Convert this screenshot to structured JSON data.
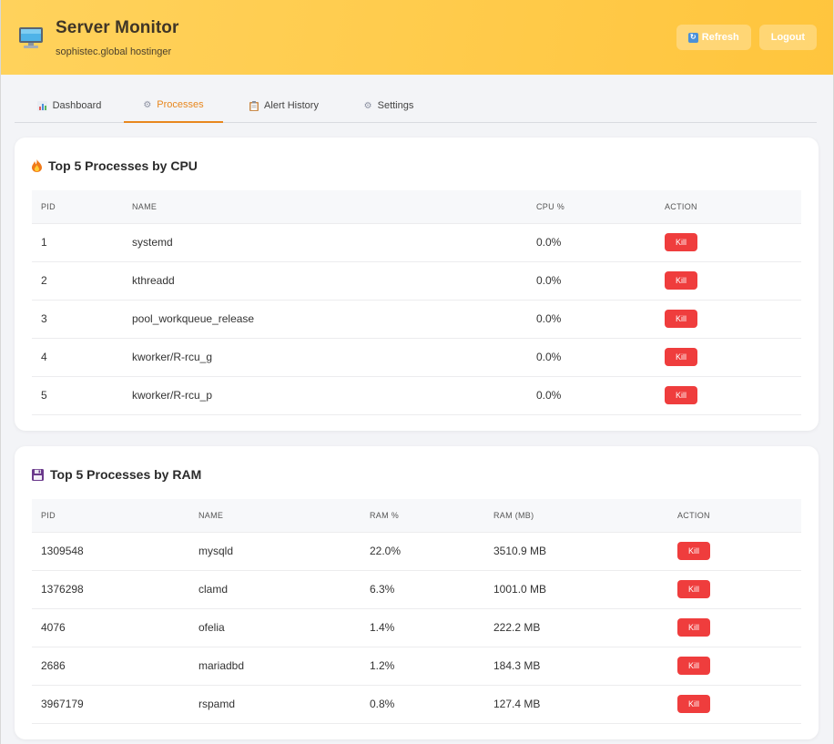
{
  "header": {
    "title": "Server Monitor",
    "subtitle": "sophistec.global hostinger",
    "refresh_label": "Refresh",
    "logout_label": "Logout",
    "logo_icon": "monitor-icon",
    "accent": "#ffc53d"
  },
  "tabs": [
    {
      "label": "Dashboard",
      "icon": "chart-icon",
      "active": false
    },
    {
      "label": "Processes",
      "icon": "gear-icon",
      "active": true
    },
    {
      "label": "Alert History",
      "icon": "clipboard-icon",
      "active": false
    },
    {
      "label": "Settings",
      "icon": "gear-icon",
      "active": false
    }
  ],
  "cpu_card": {
    "title": "Top 5 Processes by CPU",
    "icon": "fire-icon",
    "columns": [
      "PID",
      "NAME",
      "CPU %",
      "ACTION"
    ],
    "rows": [
      {
        "pid": "1",
        "name": "systemd",
        "cpu": "0.0%",
        "action": "Kill"
      },
      {
        "pid": "2",
        "name": "kthreadd",
        "cpu": "0.0%",
        "action": "Kill"
      },
      {
        "pid": "3",
        "name": "pool_workqueue_release",
        "cpu": "0.0%",
        "action": "Kill"
      },
      {
        "pid": "4",
        "name": "kworker/R-rcu_g",
        "cpu": "0.0%",
        "action": "Kill"
      },
      {
        "pid": "5",
        "name": "kworker/R-rcu_p",
        "cpu": "0.0%",
        "action": "Kill"
      }
    ]
  },
  "ram_card": {
    "title": "Top 5 Processes by RAM",
    "icon": "floppy-disk-icon",
    "columns": [
      "PID",
      "NAME",
      "RAM %",
      "RAM (MB)",
      "ACTION"
    ],
    "rows": [
      {
        "pid": "1309548",
        "name": "mysqld",
        "ram_pct": "22.0%",
        "ram_mb": "3510.9 MB",
        "action": "Kill"
      },
      {
        "pid": "1376298",
        "name": "clamd",
        "ram_pct": "6.3%",
        "ram_mb": "1001.0 MB",
        "action": "Kill"
      },
      {
        "pid": "4076",
        "name": "ofelia",
        "ram_pct": "1.4%",
        "ram_mb": "222.2 MB",
        "action": "Kill"
      },
      {
        "pid": "2686",
        "name": "mariadbd",
        "ram_pct": "1.2%",
        "ram_mb": "184.3 MB",
        "action": "Kill"
      },
      {
        "pid": "3967179",
        "name": "rspamd",
        "ram_pct": "0.8%",
        "ram_mb": "127.4 MB",
        "action": "Kill"
      }
    ]
  },
  "colors": {
    "kill_button": "#ef3d3d",
    "active_tab": "#e8871e"
  }
}
